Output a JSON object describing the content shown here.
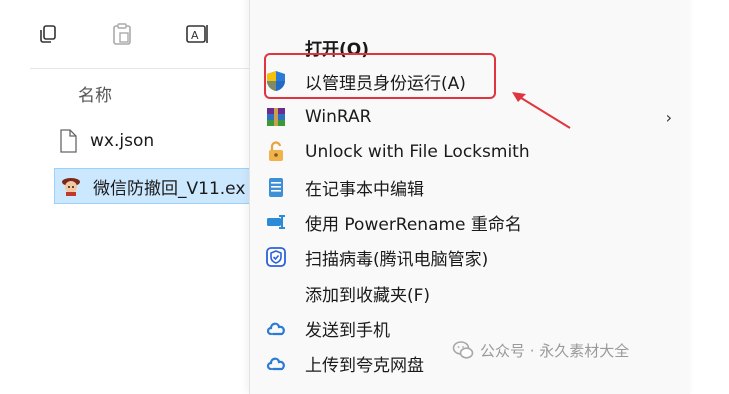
{
  "explorer": {
    "column_header": "名称",
    "files": [
      {
        "name": "wx.json",
        "icon": "document-icon"
      },
      {
        "name": "微信防撤回_V11.ex",
        "icon": "app-icon"
      }
    ],
    "toolbar_icons": [
      "copy-icon",
      "paste-icon",
      "rename-icon"
    ]
  },
  "context_menu": {
    "items": [
      {
        "label": "打开(O)",
        "icon": "none"
      },
      {
        "label": "以管理员身份运行(A)",
        "icon": "uac-shield-icon"
      },
      {
        "label": "WinRAR",
        "icon": "winrar-icon",
        "submenu_arrow": "›"
      },
      {
        "label": "Unlock with File Locksmith",
        "icon": "lock-icon"
      },
      {
        "label": "在记事本中编辑",
        "icon": "notepad-icon"
      },
      {
        "label": "使用 PowerRename 重命名",
        "icon": "powerrename-icon"
      },
      {
        "label": "扫描病毒(腾讯电脑管家)",
        "icon": "shield-check-icon"
      },
      {
        "label": "添加到收藏夹(F)",
        "icon": "none"
      },
      {
        "label": "发送到手机",
        "icon": "cloud-icon"
      },
      {
        "label": "上传到夸克网盘",
        "icon": "cloud-icon"
      }
    ]
  },
  "annotation": {
    "highlight_color": "#e0353f"
  },
  "watermark": {
    "text": "公众号 · 永久素材大全"
  },
  "colors": {
    "selection_bg": "#cce8ff",
    "menu_bg": "#f9f9f9",
    "icon_blue": "#1a73e8"
  }
}
